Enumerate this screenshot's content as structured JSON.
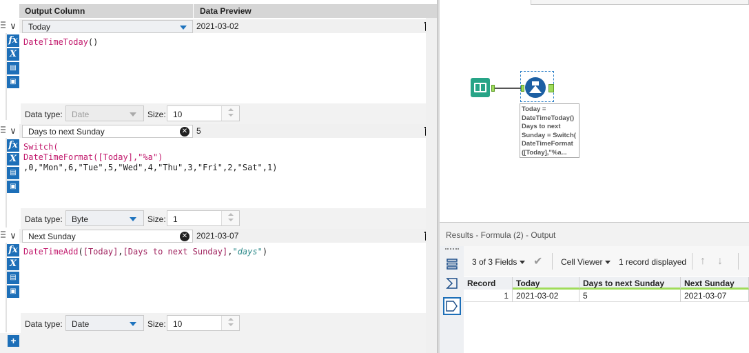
{
  "formula": {
    "header": {
      "output_column": "Output Column",
      "data_preview": "Data Preview"
    },
    "rows": [
      {
        "name": "Today",
        "preview": "2021-03-02",
        "expr": [
          "DateTimeToday",
          "()"
        ],
        "data_type_label": "Data type:",
        "data_type": "Date",
        "size_label": "Size:",
        "size": "10"
      },
      {
        "name": "Days to next Sunday",
        "preview": "5",
        "expr_lines": [
          "Switch(",
          "DateTimeFormat([Today],\"%a\")",
          ",0,\"Mon\",6,\"Tue\",5,\"Wed\",4,\"Thu\",3,\"Fri\",2,\"Sat\",1)"
        ],
        "data_type_label": "Data type:",
        "data_type": "Byte",
        "size_label": "Size:",
        "size": "1"
      },
      {
        "name": "Next Sunday",
        "preview": "2021-03-07",
        "expr": [
          "DateTimeAdd",
          "(",
          "[Today]",
          ",",
          "[Days to next Sunday]",
          ",",
          "\"days\"",
          ")"
        ],
        "data_type_label": "Data type:",
        "data_type": "Date",
        "size_label": "Size:",
        "size": "10"
      }
    ],
    "icons": {
      "fx": "fx",
      "x": "X"
    },
    "add": "+"
  },
  "canvas": {
    "annotation": "Today = DateTimeToday() Days to next Sunday = Switch( DateTimeFormat ([Today],\"%a..."
  },
  "results": {
    "title": "Results - Formula (2) - Output",
    "fields": "3 of 3 Fields",
    "viewer": "Cell Viewer",
    "records": "1 record displayed",
    "columns": [
      "Record",
      "Today",
      "Days to next Sunday",
      "Next Sunday"
    ],
    "row": [
      "1",
      "2021-03-02",
      "5",
      "2021-03-07"
    ]
  }
}
